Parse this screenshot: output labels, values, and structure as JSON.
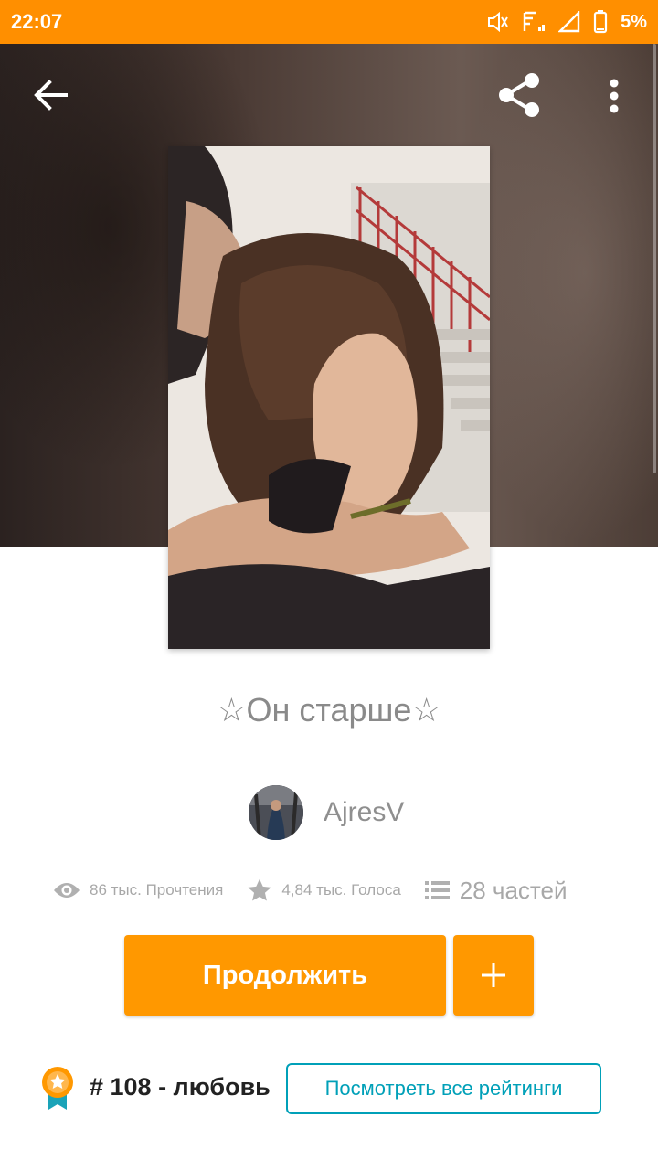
{
  "status_bar": {
    "time": "22:07",
    "battery_percent": "5%",
    "icons": [
      "mute-icon",
      "signal-icon",
      "cell-signal-icon",
      "battery-icon"
    ]
  },
  "toolbar": {
    "icons": [
      "back-arrow-icon",
      "share-icon",
      "more-vertical-icon"
    ]
  },
  "story": {
    "title": "☆Он старше☆",
    "author": "AjresV",
    "stats": {
      "views": "86 тыс. Прочтения",
      "votes": "4,84 тыс. Голоса",
      "parts": "28 частей"
    }
  },
  "actions": {
    "continue_label": "Продолжить",
    "add_icon": "plus-icon"
  },
  "ranking": {
    "text": "# 108 - любовь",
    "view_all_label": "Посмотреть все рейтинги"
  },
  "colors": {
    "accent": "#ff9800",
    "status_bar": "#ff8f00",
    "teal": "#00a0b8"
  }
}
